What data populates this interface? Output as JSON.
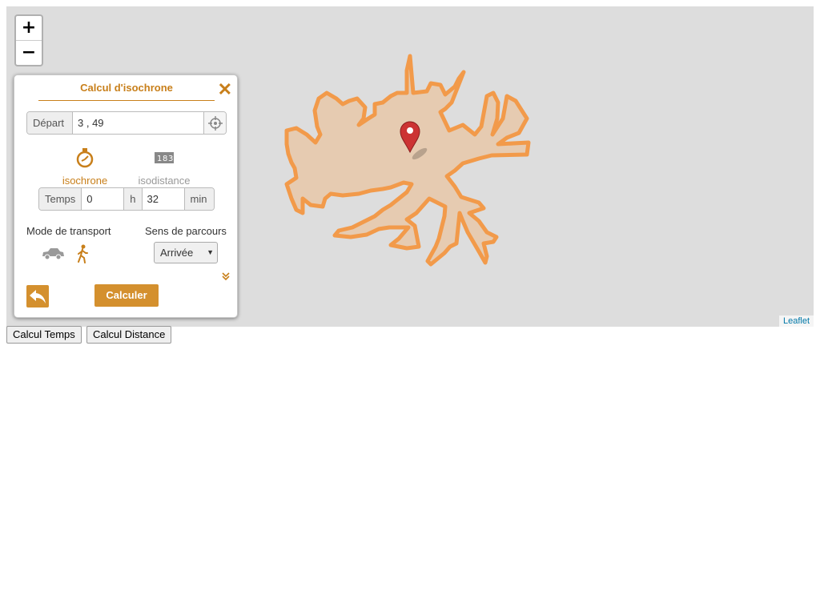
{
  "map": {
    "zoom_in_label": "+",
    "zoom_out_label": "−",
    "attribution": "Leaflet",
    "isochrone_fill": "#e9c7a6",
    "isochrone_stroke": "#f29a4a",
    "marker_color": "#cc3333"
  },
  "panel": {
    "title": "Calcul d'isochrone",
    "close_label": "✕",
    "depart_label": "Départ",
    "depart_value": "3 , 49",
    "modes": [
      {
        "label": "isochrone",
        "active": true
      },
      {
        "label": "isodistance",
        "active": false
      }
    ],
    "temps_label": "Temps",
    "hours_value": "0",
    "hours_unit": "h",
    "minutes_value": "32",
    "minutes_unit": "min",
    "transport_label": "Mode de transport",
    "transport_modes": [
      "car-icon",
      "pedestrian-icon"
    ],
    "sens_label": "Sens de parcours",
    "sens_value": "Arrivée",
    "calc_label": "Calculer",
    "accent_color": "#d4902e"
  },
  "buttons": {
    "calc_temps": "Calcul Temps",
    "calc_distance": "Calcul Distance"
  }
}
